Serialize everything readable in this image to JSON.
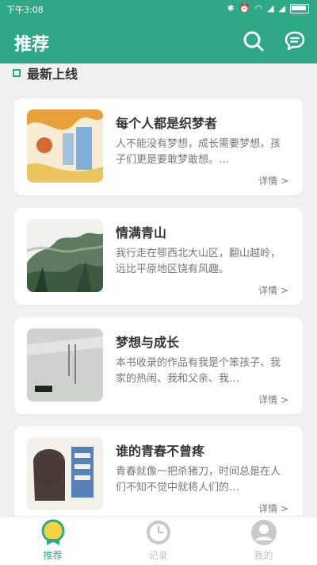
{
  "status": {
    "time": "下午3:08"
  },
  "header": {
    "title": "推荐"
  },
  "section": {
    "title": "最新上线"
  },
  "books": [
    {
      "title": "每个人都是织梦者",
      "desc": "人不能没有梦想，成长需要梦想，孩子们更是要敢梦敢想。…",
      "detail": "详情 >"
    },
    {
      "title": "情满青山",
      "desc": "我行走在鄂西北大山区，翻山越岭，远比平原地区饶有风趣。",
      "detail": "详情 >"
    },
    {
      "title": "梦想与成长",
      "desc": "本书收录的作品有我是个笨孩子、我家的热闹、我和父亲、我…",
      "detail": "详情 >"
    },
    {
      "title": "谁的青春不曾疼",
      "desc": "青春就像一把杀猪刀，时间总是在人们不知不觉中就将人们的…",
      "detail": "详情 >"
    }
  ],
  "tabs": [
    {
      "label": "推荐"
    },
    {
      "label": "记录"
    },
    {
      "label": "我的"
    }
  ],
  "colors": {
    "brand": "#2fa888",
    "background": "#eef1f0",
    "inactive": "#c0c0c0"
  }
}
